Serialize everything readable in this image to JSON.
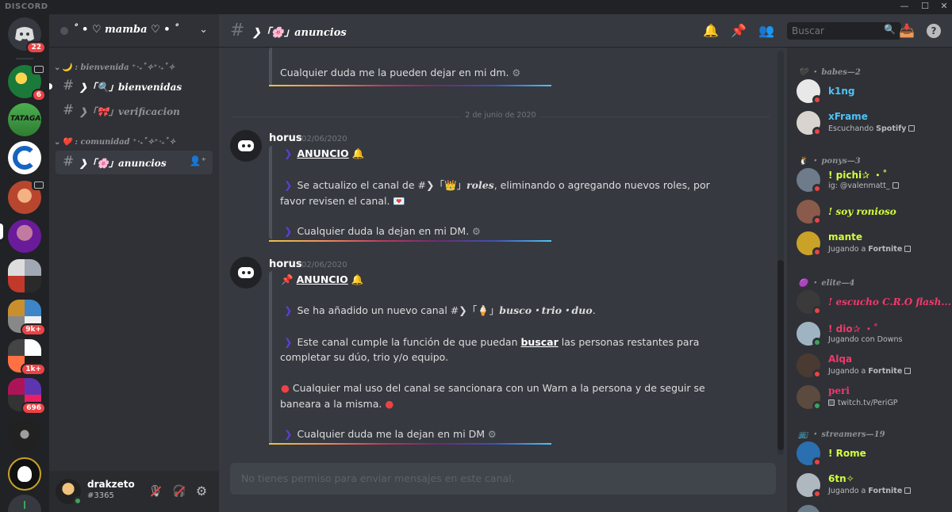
{
  "app": {
    "brand": "DISCORD"
  },
  "window_controls": [
    "—",
    "☐",
    "✕"
  ],
  "rail": {
    "home_badge": "22",
    "servers": [
      {
        "badge": "6"
      },
      {
        "badge": ""
      },
      {
        "badge": ""
      },
      {
        "badge": ""
      },
      {
        "badge": ""
      },
      {
        "badge": ""
      },
      {
        "badge": "9k+"
      },
      {
        "badge": "1k+"
      },
      {
        "badge": "696"
      },
      {
        "badge": ""
      },
      {
        "badge": ""
      }
    ]
  },
  "guild": {
    "name": "˚ • ♡ mamba ♡ • ˚",
    "chevron": "⌄"
  },
  "categories": [
    {
      "label": "🌙 : bienvenida ⁺‧₊˚✧⁺‧₊˚✧"
    },
    {
      "label": "❤️ : comunidad ⁺‧₊˚✧⁺‧₊˚✧"
    }
  ],
  "channels": [
    {
      "name": "❯「🔍」bienvenidas"
    },
    {
      "name": "❯「🎀」verificacion"
    },
    {
      "name": "❯「🌸」anuncios"
    }
  ],
  "user": {
    "name": "drakzeto",
    "tag": "#3365"
  },
  "chat": {
    "channel_name": "❯「🌸」anuncios",
    "search_placeholder": "Buscar",
    "composer_placeholder": "No tienes permiso para enviar mensajes en este canal.",
    "prev_tail": "Cualquier duda me la pueden dejar en mi dm.",
    "date_divider": "2 de junio de 2020",
    "messages": [
      {
        "author": "horus",
        "time": "02/06/2020",
        "title": "ANUNCIO",
        "l1a": "Se actualizo el canal de #❯「👑」",
        "l1b": "roles",
        "l1c": ", eliminando o agregando nuevos roles, por",
        "l2": "favor revisen el canal. 💌",
        "l3": "Cualquier duda la dejan en mi DM."
      },
      {
        "author": "horus",
        "time": "02/06/2020",
        "title": "ANUNCIO",
        "l1a": "Se ha añadido un nuevo canal #❯「🍦」",
        "l1b": "busco・trio・duo",
        "l1c": ".",
        "l2a": "Este canal cumple la función de que puedan ",
        "l2b": "buscar",
        "l2c": " las personas restantes para",
        "l3": "completar su dúo, trio y/o equipo.",
        "l4": "Cualquier mal uso del canal se sancionara con un Warn a la persona y de seguir se",
        "l5": "baneara a la misma.",
        "l6": "Cualquier duda me la dejan en mi DM"
      }
    ]
  },
  "members": {
    "groups": [
      {
        "label": "🖤 ・ babes—2"
      },
      {
        "label": "🐧 ・ ponys—3"
      },
      {
        "label": "🟣 ・ elite—4"
      },
      {
        "label": "📺 ・ streamers—19"
      }
    ],
    "list": [
      {
        "name": "k1ng",
        "activity": "",
        "color": "#4fc3f7",
        "status": "#ed4245",
        "av": "#e8e8e8"
      },
      {
        "name": "xFrame",
        "activity": "Escuchando ",
        "bold": "Spotify",
        "color": "#4fc3f7",
        "status": "#ed4245",
        "av": "#d9d4cf"
      },
      {
        "name": "! pichi✰ ・˚",
        "activity": "ig: @valenmatt_",
        "bold": "",
        "color": "#d4ff3d",
        "status": "#ed4245",
        "av": "#6d7b8a"
      },
      {
        "name": "! soy ronioso",
        "activity": "",
        "color": "#d4ff3d",
        "status": "#ed4245",
        "av": "#8a5a4a"
      },
      {
        "name": "mante",
        "activity": "Jugando a ",
        "bold": "Fortnite",
        "color": "#d4ff3d",
        "status": "#ed4245",
        "av": "#c9a227"
      },
      {
        "name": "! escucho C.R.O flash...",
        "activity": "",
        "color": "#f3386d",
        "status": "#ed4245",
        "av": "#3a3a3a"
      },
      {
        "name": "! dio✰ ・˚",
        "activity": "Jugando con Downs",
        "bold": "",
        "color": "#f3386d",
        "status": "#3ba55d",
        "av": "#9fb4c2"
      },
      {
        "name": "Alqa",
        "activity": "Jugando a ",
        "bold": "Fortnite",
        "color": "#f3386d",
        "status": "#ed4245",
        "av": "#4a3a32"
      },
      {
        "name": "peri",
        "activity": "twitch.tv/PeriGP",
        "bold": "",
        "color": "#f3386d",
        "status": "#3ba55d",
        "av": "#5b4a3e"
      },
      {
        "name": "! Rome",
        "activity": "",
        "color": "#d4ff3d",
        "status": "#ed4245",
        "av": "#2a6fb0"
      },
      {
        "name": "6tn✧",
        "activity": "Jugando a ",
        "bold": "Fortnite",
        "color": "#d4ff3d",
        "status": "#ed4245",
        "av": "#b0b8bf"
      }
    ]
  }
}
